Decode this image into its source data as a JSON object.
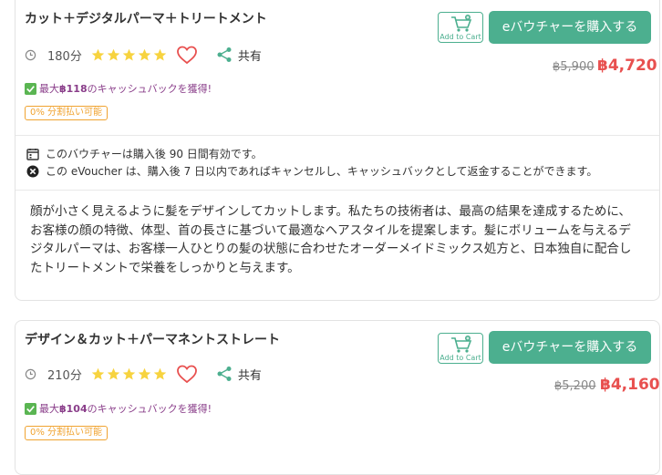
{
  "cards": [
    {
      "title": "カット＋デジタルパーマ＋トリートメント",
      "cart_label": "Add to Cart",
      "buy_label": "eバウチャーを購入する",
      "duration": "180分",
      "rating": 5,
      "share_label": "共有",
      "old_price": "฿5,900",
      "new_price": "฿4,720",
      "cashback_prefix": "最大",
      "cashback_amount": "฿118",
      "cashback_suffix": "のキャッシュバックを獲得!",
      "installment": "0% 分割払い可能",
      "validity": "このバウチャーは購入後 90 日間有効です。",
      "cancellation": "この eVoucher は、購入後 7 日以内であればキャンセルし、キャッシュバックとして返金することができます。",
      "description": "顔が小さく見えるように髪をデザインしてカットします。私たちの技術者は、最高の結果を達成するために、お客様の顔の特徴、体型、首の長さに基づいて最適なヘアスタイルを提案します。髪にボリュームを与えるデジタルパーマは、お客様一人ひとりの髪の状態に合わせたオーダーメイドミックス処方と、日本独自に配合したトリートメントで栄養をしっかりと与えます。"
    },
    {
      "title": "デザイン＆カット＋パーマネントストレート",
      "cart_label": "Add to Cart",
      "buy_label": "eバウチャーを購入する",
      "duration": "210分",
      "rating": 5,
      "share_label": "共有",
      "old_price": "฿5,200",
      "new_price": "฿4,160",
      "cashback_prefix": "最大",
      "cashback_amount": "฿104",
      "cashback_suffix": "のキャッシュバックを獲得!",
      "installment": "0% 分割払い可能"
    }
  ],
  "colors": {
    "accent": "#4caf8f",
    "price_red": "#e8504f",
    "star": "#f7d33f",
    "cashback": "#8a3e8a",
    "installment": "#f0a330"
  }
}
